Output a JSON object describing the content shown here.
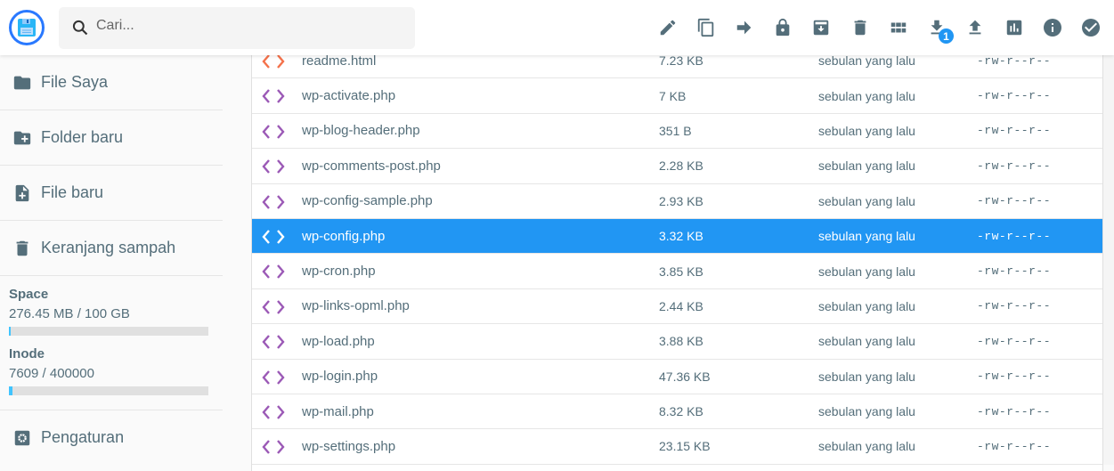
{
  "header": {
    "search_placeholder": "Cari...",
    "download_badge": "1",
    "toolbar": [
      "edit",
      "copy",
      "move",
      "permissions",
      "archive",
      "delete",
      "view-mode",
      "download",
      "upload",
      "info-chart",
      "info",
      "select"
    ]
  },
  "sidebar": {
    "items": [
      {
        "label": "File Saya",
        "icon": "folder-icon"
      },
      {
        "label": "Folder baru",
        "icon": "folder-plus-icon"
      },
      {
        "label": "File baru",
        "icon": "file-plus-icon"
      },
      {
        "label": "Keranjang sampah",
        "icon": "trash-icon"
      }
    ],
    "space": {
      "label": "Space",
      "value": "276.45 MB / 100 GB",
      "fraction": 0.0027
    },
    "inode": {
      "label": "Inode",
      "value": "7609 / 400000",
      "fraction": 0.019
    },
    "settings": "Pengaturan"
  },
  "colors": {
    "accent": "#2196f3",
    "html_icon": "#f4714a",
    "php_icon": "#9b59b6"
  },
  "files": [
    {
      "name": "readme.html",
      "size": "7.23 KB",
      "modified": "sebulan yang lalu",
      "perm": "-rw-r--r--",
      "type": "html"
    },
    {
      "name": "wp-activate.php",
      "size": "7 KB",
      "modified": "sebulan yang lalu",
      "perm": "-rw-r--r--",
      "type": "php"
    },
    {
      "name": "wp-blog-header.php",
      "size": "351 B",
      "modified": "sebulan yang lalu",
      "perm": "-rw-r--r--",
      "type": "php"
    },
    {
      "name": "wp-comments-post.php",
      "size": "2.28 KB",
      "modified": "sebulan yang lalu",
      "perm": "-rw-r--r--",
      "type": "php"
    },
    {
      "name": "wp-config-sample.php",
      "size": "2.93 KB",
      "modified": "sebulan yang lalu",
      "perm": "-rw-r--r--",
      "type": "php"
    },
    {
      "name": "wp-config.php",
      "size": "3.32 KB",
      "modified": "sebulan yang lalu",
      "perm": "-rw-r--r--",
      "type": "php",
      "selected": true
    },
    {
      "name": "wp-cron.php",
      "size": "3.85 KB",
      "modified": "sebulan yang lalu",
      "perm": "-rw-r--r--",
      "type": "php"
    },
    {
      "name": "wp-links-opml.php",
      "size": "2.44 KB",
      "modified": "sebulan yang lalu",
      "perm": "-rw-r--r--",
      "type": "php"
    },
    {
      "name": "wp-load.php",
      "size": "3.88 KB",
      "modified": "sebulan yang lalu",
      "perm": "-rw-r--r--",
      "type": "php"
    },
    {
      "name": "wp-login.php",
      "size": "47.36 KB",
      "modified": "sebulan yang lalu",
      "perm": "-rw-r--r--",
      "type": "php"
    },
    {
      "name": "wp-mail.php",
      "size": "8.32 KB",
      "modified": "sebulan yang lalu",
      "perm": "-rw-r--r--",
      "type": "php"
    },
    {
      "name": "wp-settings.php",
      "size": "23.15 KB",
      "modified": "sebulan yang lalu",
      "perm": "-rw-r--r--",
      "type": "php"
    }
  ]
}
